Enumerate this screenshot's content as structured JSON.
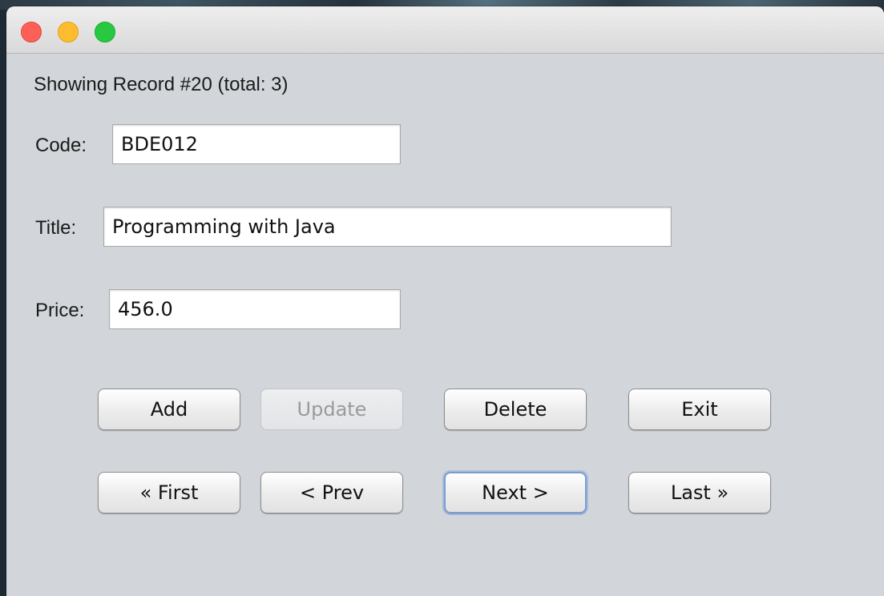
{
  "window": {
    "controls": [
      "close",
      "minimize",
      "zoom"
    ]
  },
  "status_text": "Showing Record #20 (total: 3)",
  "form": {
    "code_label": "Code:",
    "code_value": "BDE012",
    "title_label": "Title:",
    "title_value": "Programming with Java",
    "price_label": "Price:",
    "price_value": "456.0"
  },
  "actions": {
    "add": "Add",
    "update": "Update",
    "delete": "Delete",
    "exit": "Exit"
  },
  "navigation": {
    "first": "« First",
    "prev": "< Prev",
    "next": "Next >",
    "last": "Last »"
  },
  "colors": {
    "window_bg": "#d2d6da",
    "close": "#fe5f57",
    "minimize": "#febc2e",
    "zoom": "#28c840",
    "focus_ring": "#7a9dd2"
  }
}
